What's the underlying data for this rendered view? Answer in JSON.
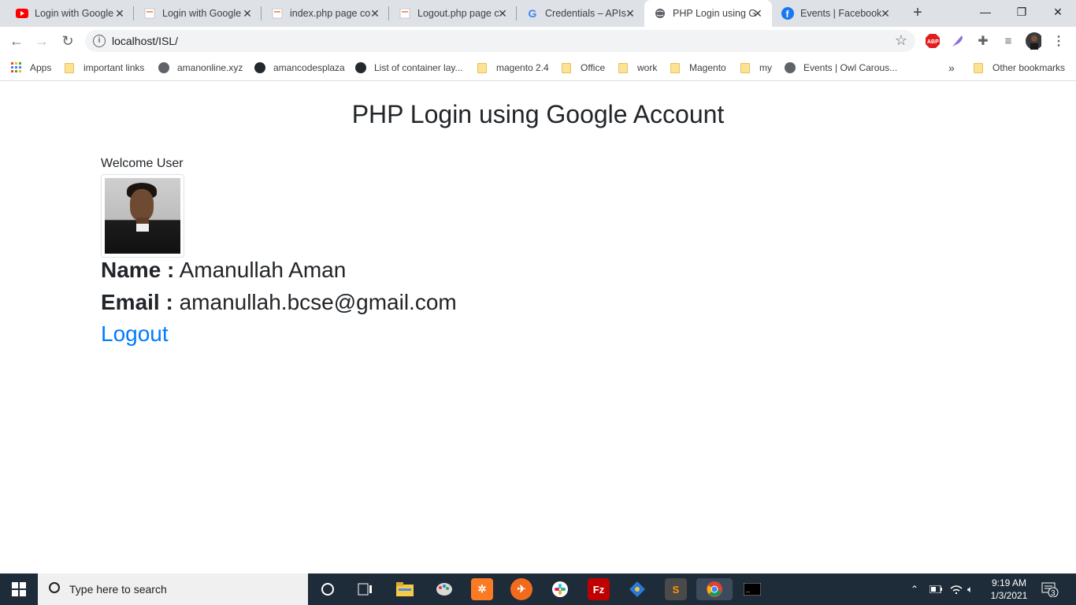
{
  "browser": {
    "tabs": [
      {
        "title": "Login with Google",
        "icon": "youtube-icon",
        "color": "#ff0000"
      },
      {
        "title": "Login with Google",
        "icon": "page-icon",
        "color": "#f29b71"
      },
      {
        "title": "index.php page co",
        "icon": "page-icon",
        "color": "#f29b71"
      },
      {
        "title": "Logout.php page c",
        "icon": "page-icon",
        "color": "#f29b71"
      },
      {
        "title": "Credentials – APIs",
        "icon": "google-icon",
        "color": "#4285f4"
      },
      {
        "title": "PHP Login using G",
        "icon": "globe-icon",
        "color": "#5f6368",
        "active": true
      },
      {
        "title": "Events | Facebook",
        "icon": "facebook-icon",
        "color": "#1877f2"
      }
    ],
    "url": "localhost/ISL/",
    "bookmarks": [
      {
        "label": "Apps",
        "icon": "apps-grid-icon"
      },
      {
        "label": "important links",
        "icon": "folder-icon"
      },
      {
        "label": "amanonline.xyz",
        "icon": "globe-icon"
      },
      {
        "label": "amancodesplaza",
        "icon": "github-icon"
      },
      {
        "label": "List of container lay...",
        "icon": "github-icon"
      },
      {
        "label": "magento 2.4",
        "icon": "folder-icon"
      },
      {
        "label": "Office",
        "icon": "folder-icon"
      },
      {
        "label": "work",
        "icon": "folder-icon"
      },
      {
        "label": "Magento",
        "icon": "folder-icon"
      },
      {
        "label": "my",
        "icon": "folder-icon"
      },
      {
        "label": "Events | Owl Carous...",
        "icon": "globe-icon"
      }
    ],
    "bookmarks_overflow": "»",
    "other_bookmarks": "Other bookmarks",
    "abp_label": "ABP"
  },
  "page": {
    "heading": "PHP Login using Google Account",
    "welcome": "Welcome User",
    "name_label": "Name :",
    "name_value": "Amanullah Aman",
    "email_label": "Email :",
    "email_value": "amanullah.bcse@gmail.com",
    "logout": "Logout"
  },
  "taskbar": {
    "search_placeholder": "Type here to search",
    "time": "9:19 AM",
    "date": "1/3/2021",
    "notification_count": "3"
  }
}
